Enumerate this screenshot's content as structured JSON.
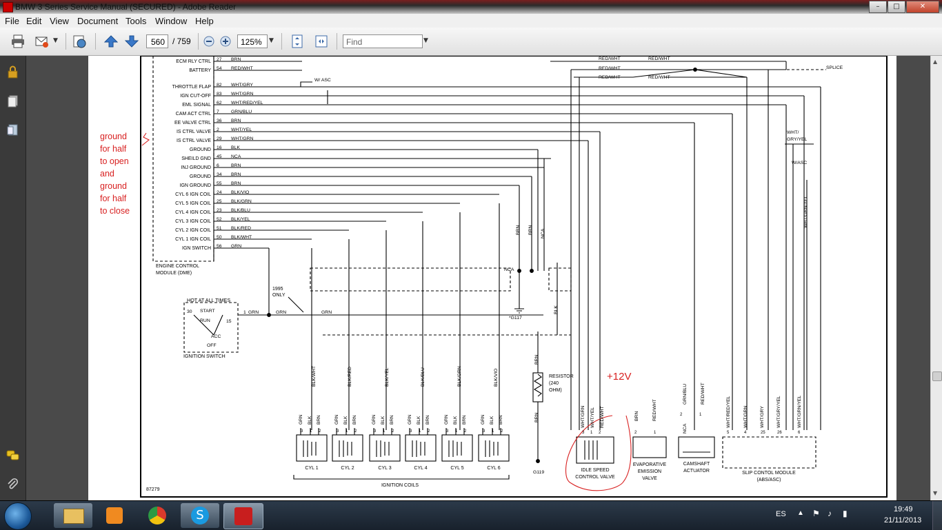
{
  "window": {
    "title": "BMW 3 Series Service Manual (SECURED) - Adobe Reader",
    "controls": {
      "minimize": "–",
      "maximize": "□",
      "close": "✕"
    }
  },
  "menu": [
    "File",
    "Edit",
    "View",
    "Document",
    "Tools",
    "Window",
    "Help"
  ],
  "toolbar": {
    "page_current": "560",
    "page_total": "/ 759",
    "zoom": "125%",
    "find_placeholder": "Find"
  },
  "diagram": {
    "dme_pins": [
      {
        "label": "ECM RLY CTRL",
        "pin": "27",
        "wire": "BRN"
      },
      {
        "label": "BATTERY",
        "pin": "54",
        "wire": "RED/WHT"
      },
      {
        "label": "THROTTLE FLAP",
        "pin": "82",
        "wire": "WHT/GRY"
      },
      {
        "label": "IGN CUT-OFF",
        "pin": "83",
        "wire": "WHT/GRN"
      },
      {
        "label": "EML SIGNAL",
        "pin": "62",
        "wire": "WHT/RED/YEL"
      },
      {
        "label": "CAM ACT CTRL",
        "pin": "7",
        "wire": "GRN/BLU"
      },
      {
        "label": "EE VALVE CTRL",
        "pin": "36",
        "wire": "BRN"
      },
      {
        "label": "IS CTRL VALVE",
        "pin": "2",
        "wire": "WHT/YEL"
      },
      {
        "label": "IS CTRL VALVE",
        "pin": "29",
        "wire": "WHT/GRN"
      },
      {
        "label": "GROUND",
        "pin": "16",
        "wire": "BLK"
      },
      {
        "label": "SHEILD GND",
        "pin": "45",
        "wire": "NCA"
      },
      {
        "label": "INJ GROUND",
        "pin": "6",
        "wire": "BRN"
      },
      {
        "label": "GROUND",
        "pin": "34",
        "wire": "BRN"
      },
      {
        "label": "IGN GROUND",
        "pin": "55",
        "wire": "BRN"
      },
      {
        "label": "CYL 6 IGN COIL",
        "pin": "24",
        "wire": "BLK/VIO"
      },
      {
        "label": "CYL 5 IGN COIL",
        "pin": "25",
        "wire": "BLK/GRN"
      },
      {
        "label": "CYL 4 IGN COIL",
        "pin": "23",
        "wire": "BLK/BLU"
      },
      {
        "label": "CYL 3 IGN COIL",
        "pin": "52",
        "wire": "BLK/YEL"
      },
      {
        "label": "CYL 2 IGN COIL",
        "pin": "51",
        "wire": "BLK/RED"
      },
      {
        "label": "CYL 1 IGN COIL",
        "pin": "50",
        "wire": "BLK/WHT"
      },
      {
        "label": "IGN SWITCH",
        "pin": "56",
        "wire": "GRN"
      }
    ],
    "dme_caption": [
      "ENGINE CONTROL",
      "MODULE (DME)"
    ],
    "handwritten_note": [
      "ground",
      "for half",
      "to open",
      "and",
      "ground",
      "for half",
      "to close"
    ],
    "handwritten_voltage": "+12V",
    "top_wires": [
      "RED/WHT",
      "RED/WHT",
      "RED/WHT",
      "RED/WHT",
      "RED/WHT"
    ],
    "splice_label": "SPLICE",
    "w_asc_label": "W/ ASC",
    "w_asc_right": "W/ASC",
    "wht_gry_yel": [
      "WHT/",
      "GRY/YEL"
    ],
    "ign_switch": {
      "title": "HOT AT ALL TIMES",
      "caption": "IGNITION SWITCH",
      "pins": [
        "30",
        "15",
        "1"
      ],
      "positions": [
        "START",
        "RUN",
        "ACC",
        "OFF"
      ],
      "wires": [
        "GRN",
        "GRN",
        "GRN"
      ]
    },
    "year_note": [
      "1995",
      "ONLY"
    ],
    "nca_label": "NCA",
    "g117": "*G117",
    "g119": "G119",
    "coil_wires": [
      "BLK/WHT",
      "BLK/RED",
      "BLK/YEL",
      "BLK/BLU",
      "BLK/GRN",
      "BLK/VIO"
    ],
    "coil_pin_wires": [
      "GRN",
      "BLK",
      "BRN"
    ],
    "coil_pins": [
      "3",
      "1",
      "2"
    ],
    "coils": [
      "CYL 1",
      "CYL 2",
      "CYL 3",
      "CYL 4",
      "CYL 5",
      "CYL 6"
    ],
    "coils_caption": "IGNITION COILS",
    "resistor": [
      "RESISTOR",
      "(240",
      "OHM)"
    ],
    "vertical_wires": {
      "brn": "BRN",
      "nca": "NCA",
      "blk": "BLK"
    },
    "idle_valve": {
      "wires": [
        "WHT/GRN",
        "WHT/YEL",
        "RED/WHT"
      ],
      "pins": [
        "3",
        "1",
        "2"
      ],
      "caption": [
        "IDLE SPEED",
        "CONTROL VALVE"
      ]
    },
    "evap_valve": {
      "wires": [
        "BRN",
        "RED/WHT"
      ],
      "pins": [
        "2",
        "1"
      ],
      "caption": [
        "EVAPORATIVE",
        "EMISSION",
        "VALVE"
      ]
    },
    "camshaft": {
      "wires": [
        "GRN/BLU",
        "RED/WHT"
      ],
      "pins": [
        "2",
        "1"
      ],
      "caption": [
        "CAMSHAFT",
        "ACTUATOR"
      ],
      "nca": "NCA"
    },
    "slip_module": {
      "wires": [
        "WHT/RED/YEL",
        "WHT/GRN",
        "WHT/GRY",
        "WHT/GRY/YEL",
        "WHT/GRN/YEL"
      ],
      "pins": [
        "5",
        "4",
        "25",
        "26",
        "6"
      ],
      "caption": [
        "SLIP CONTOL MODULE",
        "(ABS/ASC)"
      ]
    },
    "right_vertical_wire": "WHT/GRN/YEL",
    "figure_number": "87279"
  },
  "taskbar": {
    "language": "ES",
    "time": "19:49",
    "date": "21/11/2013"
  },
  "icons": {
    "print": "printer-icon",
    "email": "envelope-icon",
    "prev": "arrow-up-icon",
    "next": "arrow-down-icon",
    "zoom_out": "minus-circle-icon",
    "zoom_in": "plus-circle-icon",
    "fit_page": "fit-page-icon",
    "fit_width": "fit-width-icon"
  }
}
